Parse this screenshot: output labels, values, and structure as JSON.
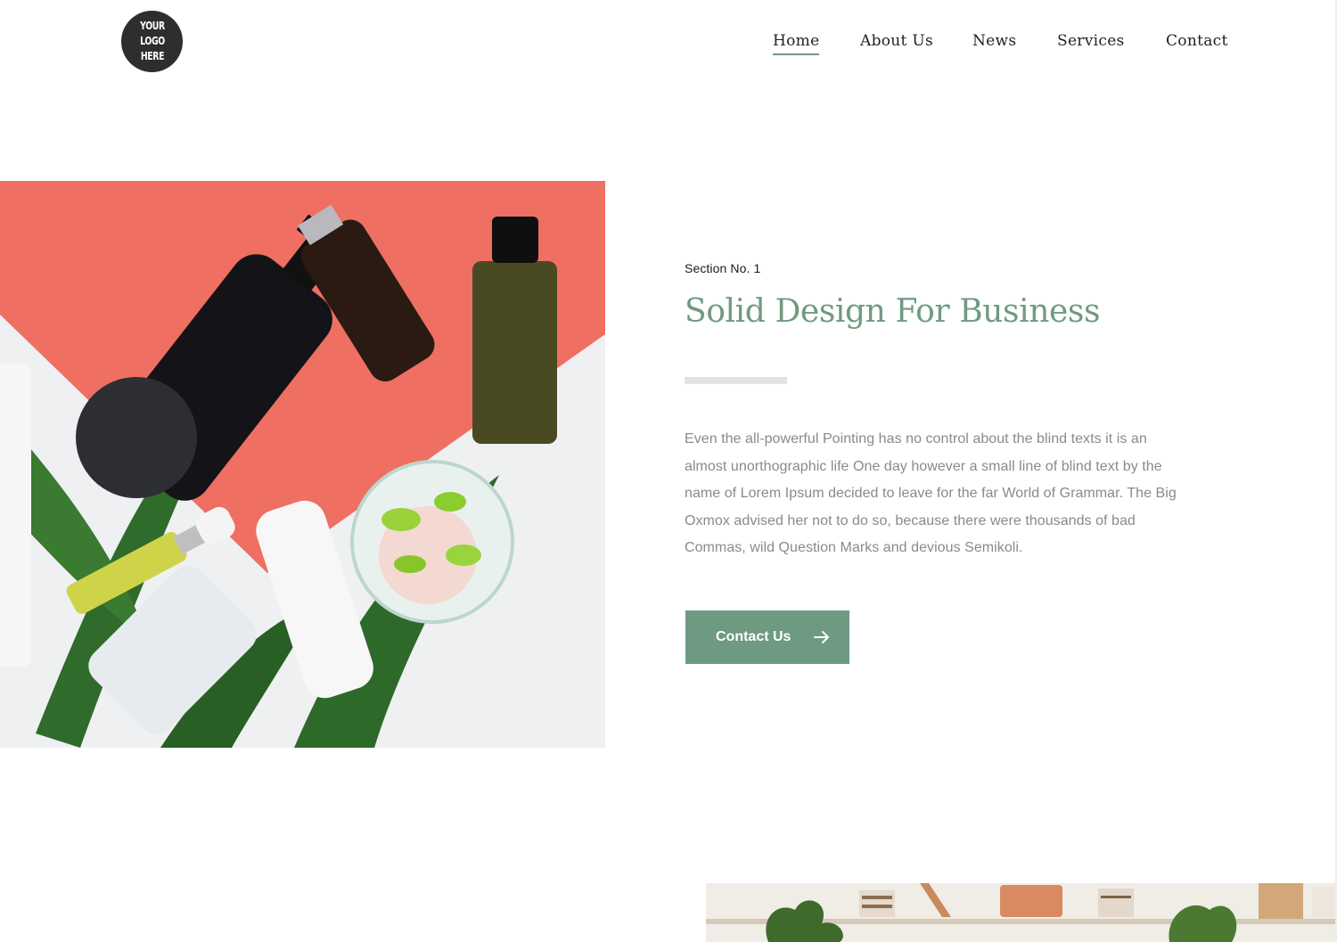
{
  "header": {
    "logo_text": "YOUR LOGO HERE",
    "nav": [
      {
        "label": "Home",
        "active": true
      },
      {
        "label": "About Us",
        "active": false
      },
      {
        "label": "News",
        "active": false
      },
      {
        "label": "Services",
        "active": false
      },
      {
        "label": "Contact",
        "active": false
      }
    ]
  },
  "hero": {
    "eyebrow": "Section No. 1",
    "title": "Solid Design For Business",
    "body": "Even the all-powerful Pointing has no control about the blind texts it is an almost unorthographic life One day however a small line of blind text by the name of Lorem Ipsum decided to leave for the far World of Grammar. The Big Oxmox advised her not to do so, because there were thousands of bad Commas, wild Question Marks and devious Semikoli.",
    "cta_label": "Contact Us",
    "cta_icon": "arrow-right-icon"
  },
  "colors": {
    "accent": "#6f9a82",
    "coral": "#ef6f63",
    "text_muted": "#8a8a8a",
    "logo_bg": "#2e2e2e"
  }
}
